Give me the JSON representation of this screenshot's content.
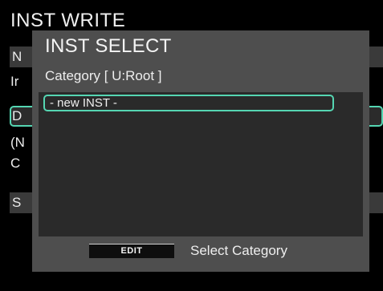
{
  "background": {
    "title": "INST WRITE",
    "row1_letter": "N",
    "text1": "Ir",
    "row2_letter": "D",
    "text2": "(N",
    "text3": "C",
    "row3_letter": "S"
  },
  "dialog": {
    "title": "INST SELECT",
    "category_label": "Category [ U:Root ]",
    "list": [
      {
        "label": "- new INST -",
        "selected": true
      }
    ],
    "edit_button": "EDIT",
    "footer_label": "Select Category"
  },
  "colors": {
    "accent": "#55d6b2",
    "dialog_bg": "#4e4e4e",
    "list_bg": "#2a2a2a",
    "screen_bg": "#000000"
  }
}
